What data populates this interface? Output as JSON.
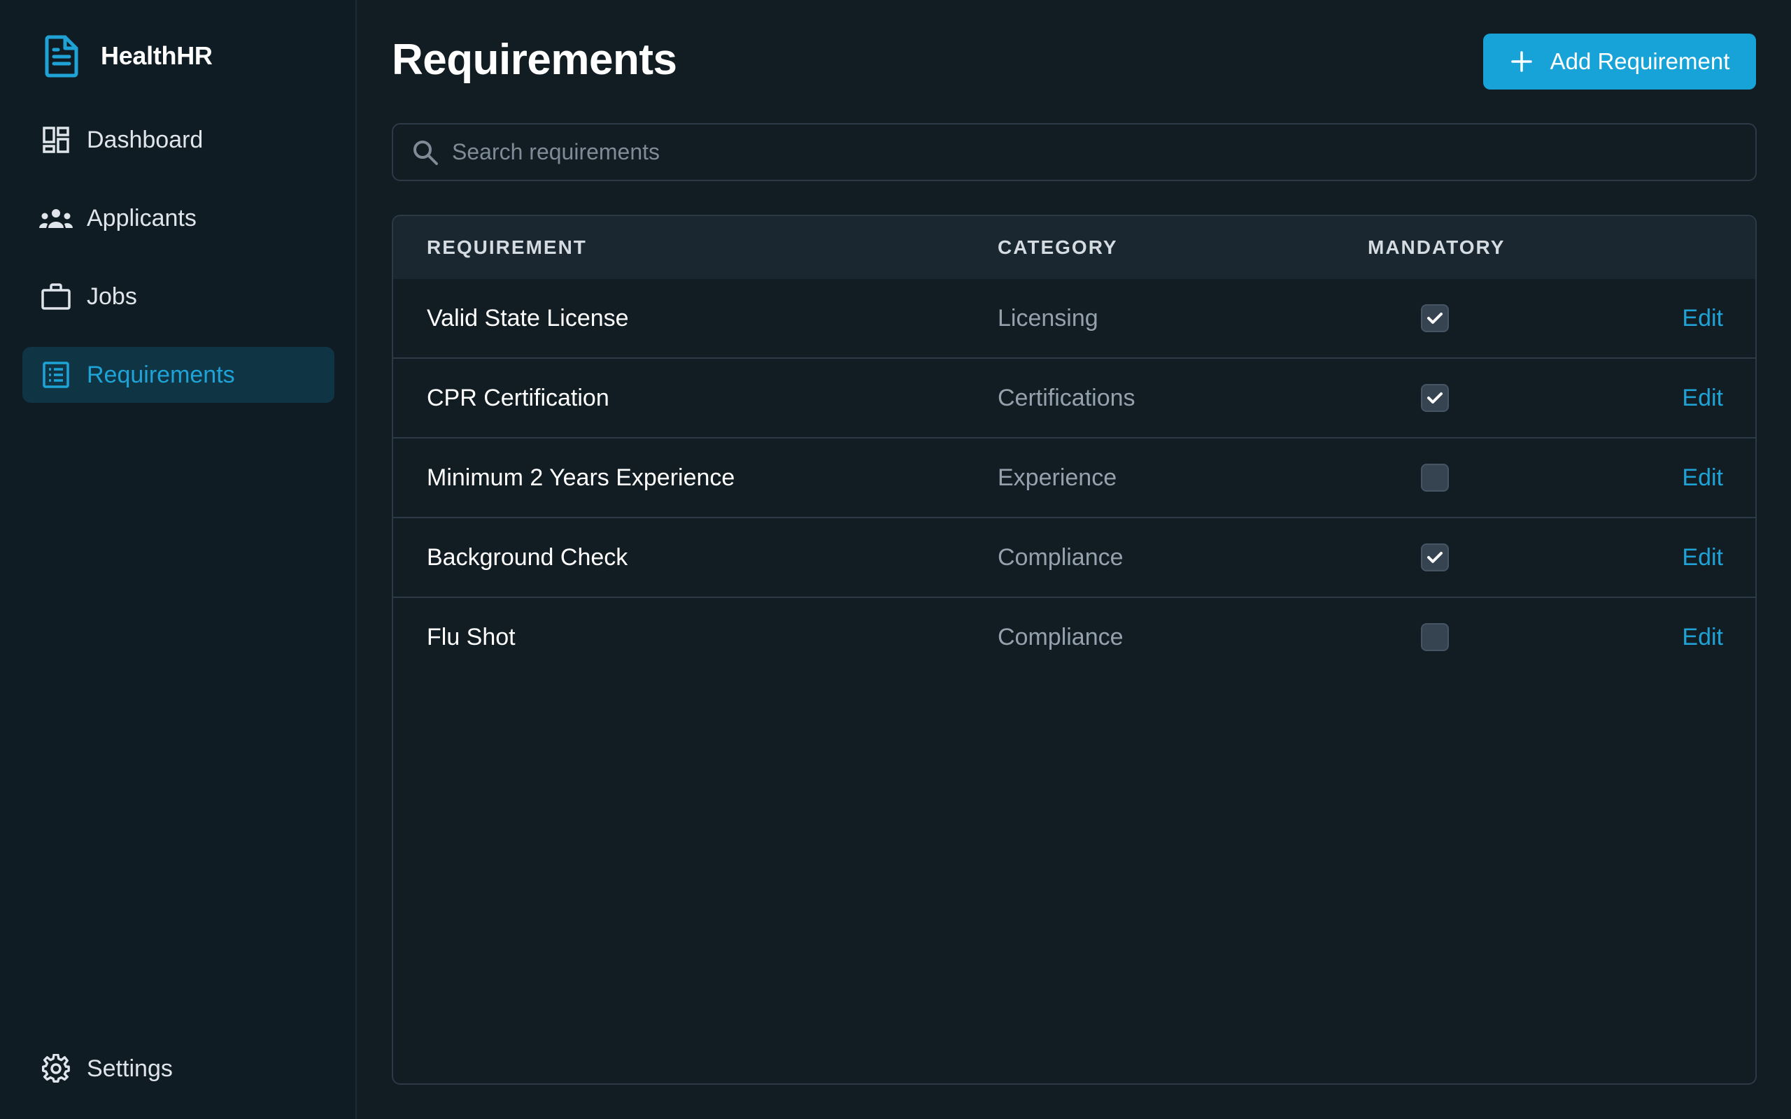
{
  "app": {
    "name": "HealthHR"
  },
  "sidebar": {
    "items": [
      {
        "label": "Dashboard",
        "icon": "dashboard-icon"
      },
      {
        "label": "Applicants",
        "icon": "people-icon"
      },
      {
        "label": "Jobs",
        "icon": "briefcase-icon"
      },
      {
        "label": "Requirements",
        "icon": "list-icon",
        "active": true
      }
    ],
    "footer": {
      "label": "Settings",
      "icon": "gear-icon"
    }
  },
  "header": {
    "title": "Requirements",
    "add_button_label": "Add Requirement"
  },
  "search": {
    "placeholder": "Search requirements",
    "value": ""
  },
  "table": {
    "columns": [
      "REQUIREMENT",
      "CATEGORY",
      "MANDATORY"
    ],
    "rows": [
      {
        "requirement": "Valid State License",
        "category": "Licensing",
        "mandatory": true,
        "action": "Edit"
      },
      {
        "requirement": "CPR Certification",
        "category": "Certifications",
        "mandatory": true,
        "action": "Edit"
      },
      {
        "requirement": "Minimum 2 Years Experience",
        "category": "Experience",
        "mandatory": false,
        "action": "Edit"
      },
      {
        "requirement": "Background Check",
        "category": "Compliance",
        "mandatory": true,
        "action": "Edit"
      },
      {
        "requirement": "Flu Shot",
        "category": "Compliance",
        "mandatory": false,
        "action": "Edit"
      }
    ]
  },
  "colors": {
    "accent": "#17a3d8",
    "background": "#111c23",
    "active_nav_bg": "#0f3545"
  }
}
